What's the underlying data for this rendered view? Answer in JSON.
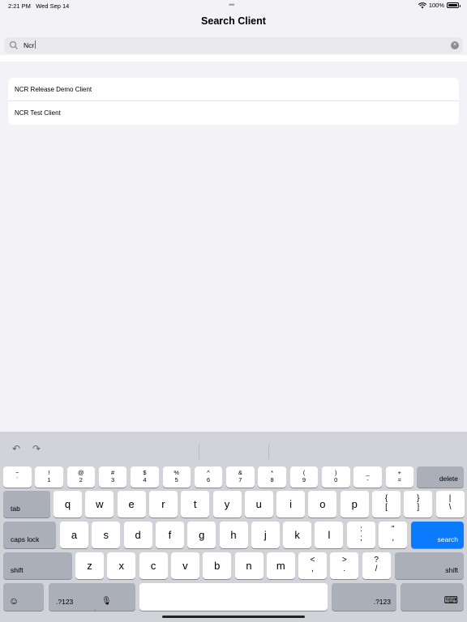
{
  "status_bar": {
    "time": "2:21 PM",
    "date": "Wed Sep 14",
    "multitasking_dots": "•••",
    "battery": "100%"
  },
  "header": {
    "title": "Search Client"
  },
  "search": {
    "query": "Ncr",
    "clear_glyph": "×"
  },
  "results": [
    {
      "label": "NCR Release Demo Client"
    },
    {
      "label": "NCR Test Client"
    }
  ],
  "keyboard": {
    "toolbar": {
      "undo": "↶",
      "redo": "↷"
    },
    "number_row": [
      {
        "top": "~",
        "bot": "`"
      },
      {
        "top": "!",
        "bot": "1"
      },
      {
        "top": "@",
        "bot": "2"
      },
      {
        "top": "#",
        "bot": "3"
      },
      {
        "top": "$",
        "bot": "4"
      },
      {
        "top": "%",
        "bot": "5"
      },
      {
        "top": "^",
        "bot": "6"
      },
      {
        "top": "&",
        "bot": "7"
      },
      {
        "top": "*",
        "bot": "8"
      },
      {
        "top": "(",
        "bot": "9"
      },
      {
        "top": ")",
        "bot": "0"
      },
      {
        "top": "_",
        "bot": "-"
      },
      {
        "top": "+",
        "bot": "="
      }
    ],
    "delete": "delete",
    "tab": "tab",
    "row_q": [
      "q",
      "w",
      "e",
      "r",
      "t",
      "y",
      "u",
      "i",
      "o",
      "p"
    ],
    "row_q_extra": [
      {
        "top": "{",
        "bot": "["
      },
      {
        "top": "}",
        "bot": "]"
      },
      {
        "top": "|",
        "bot": "\\"
      }
    ],
    "caps_lock": "caps lock",
    "row_a": [
      "a",
      "s",
      "d",
      "f",
      "g",
      "h",
      "j",
      "k",
      "l"
    ],
    "row_a_extra": [
      {
        "top": ":",
        "bot": ";"
      },
      {
        "top": "\"",
        "bot": ","
      }
    ],
    "search_key": "search",
    "shift": "shift",
    "row_z": [
      "z",
      "x",
      "c",
      "v",
      "b",
      "n",
      "m"
    ],
    "row_z_extra": [
      {
        "top": "<",
        "bot": ","
      },
      {
        "top": ">",
        "bot": "."
      },
      {
        "top": "?",
        "bot": "/"
      }
    ],
    "emoji": "☺",
    "numbers_toggle": ".?123",
    "mic": "🎙",
    "hide_keyboard": "⌨"
  }
}
